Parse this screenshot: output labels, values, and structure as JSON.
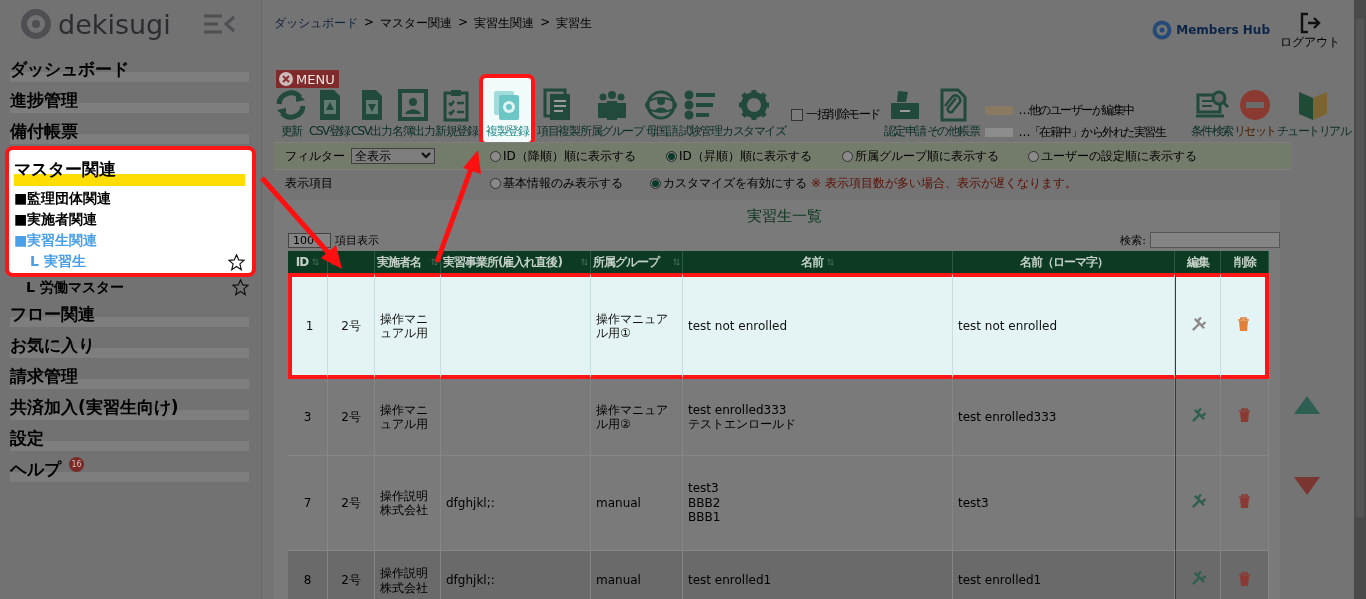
{
  "sidebar": {
    "logo": "dekisugi",
    "nav": [
      {
        "label": "ダッシュボード",
        "selected": false,
        "highlighted": false
      },
      {
        "label": "進捗管理",
        "selected": false,
        "highlighted": false
      },
      {
        "label": "備付帳票",
        "selected": false,
        "highlighted": false
      },
      {
        "label": "マスター関連",
        "selected": true,
        "highlighted": true,
        "children": [
          {
            "label": "■監理団体関連",
            "selected": false,
            "highlighted": true
          },
          {
            "label": "■実施者関連",
            "selected": false,
            "highlighted": true
          },
          {
            "label": "■実習生関連",
            "selected": true,
            "highlighted": true,
            "children": [
              {
                "label": "L 実習生",
                "selected": true,
                "highlighted": true,
                "favorite": false
              },
              {
                "label": "L 労働マスター",
                "selected": false,
                "highlighted": false,
                "favorite": false
              }
            ]
          }
        ]
      },
      {
        "label": "フロー関連",
        "selected": false,
        "highlighted": false
      },
      {
        "label": "お気に入り",
        "selected": false,
        "highlighted": false
      },
      {
        "label": "請求管理",
        "selected": false,
        "highlighted": false
      },
      {
        "label": "共済加入(実習生向け)",
        "selected": false,
        "highlighted": false
      },
      {
        "label": "設定",
        "selected": false,
        "highlighted": false
      },
      {
        "label": "ヘルプ",
        "selected": false,
        "highlighted": false,
        "badge": "16"
      }
    ]
  },
  "header": {
    "breadcrumb": [
      {
        "label": "ダッシュボード",
        "kind": "link"
      },
      {
        "label": ">",
        "kind": "separator"
      },
      {
        "label": "マスター関連",
        "kind": "text"
      },
      {
        "label": ">",
        "kind": "separator"
      },
      {
        "label": "実習生関連",
        "kind": "text"
      },
      {
        "label": ">",
        "kind": "separator"
      },
      {
        "label": "実習生",
        "kind": "text"
      }
    ],
    "brand": "Members Hub",
    "logout": "ログアウト"
  },
  "menu_button": "MENU",
  "toolbar": {
    "buttons": [
      {
        "label": "更新",
        "kind": "refresh",
        "highlighted": false
      },
      {
        "label": "CSV登録",
        "kind": "upload",
        "highlighted": false
      },
      {
        "label": "CSV出力",
        "kind": "download",
        "highlighted": false
      },
      {
        "label": "名簿出力",
        "kind": "portrait",
        "highlighted": false
      },
      {
        "label": "新規登録",
        "kind": "checklist",
        "highlighted": false
      },
      {
        "label": "複製登録",
        "kind": "copy",
        "highlighted": true
      },
      {
        "label": "項目複製",
        "kind": "docs",
        "highlighted": false
      },
      {
        "label": "所属グループ",
        "kind": "group",
        "highlighted": false
      },
      {
        "label": "母国語",
        "kind": "globe",
        "highlighted": false
      },
      {
        "label": "試験管理",
        "kind": "list",
        "highlighted": false
      },
      {
        "label": "カスタマイズ",
        "kind": "gear",
        "highlighted": false
      }
    ],
    "bulk_delete": {
      "label": "一括削除モード",
      "checked": false
    },
    "doc_buttons": [
      {
        "label": "認定申請",
        "kind": "printer",
        "highlighted": false
      },
      {
        "label": "その他帳票",
        "kind": "clip",
        "highlighted": false
      }
    ],
    "legend": [
      {
        "label": "…他のユーザーが編集中",
        "color": "#8a7a62"
      },
      {
        "label": "…「在籍中」から外れた実習生",
        "color": "#8c8c8c"
      }
    ],
    "tool_buttons": [
      {
        "label": "条件検索",
        "kind": "search",
        "highlighted": false
      },
      {
        "label": "リセット",
        "kind": "reset",
        "highlighted": false
      },
      {
        "label": "チュートリアル",
        "kind": "beginner",
        "highlighted": false
      }
    ]
  },
  "filter": {
    "label": "フィルター",
    "select": "全表示",
    "options": [
      {
        "label": "ID（降順）順に表示する",
        "selected": false
      },
      {
        "label": "ID（昇順）順に表示する",
        "selected": true
      },
      {
        "label": "所属グループ順に表示する",
        "selected": false
      },
      {
        "label": "ユーザーの設定順に表示する",
        "selected": false
      }
    ]
  },
  "display": {
    "label": "表示項目",
    "options": [
      {
        "label": "基本情報のみ表示する",
        "selected": false
      },
      {
        "label": "カスタマイズを有効にする",
        "selected": true
      }
    ],
    "note": "※ 表示項目数が多い場合、表示が遅くなります。"
  },
  "list": {
    "title": "実習生一覧",
    "page_size": "100",
    "page_size_label": "項目表示",
    "search_label": "検索:",
    "columns": [
      {
        "label": "ID",
        "sortable": true,
        "kind": "text"
      },
      {
        "sortable": true,
        "kind": "text"
      },
      {
        "label": "実施者名",
        "sortable": true,
        "kind": "text"
      },
      {
        "label": "実習事業所(雇入れ直後)",
        "sortable": true,
        "kind": "text"
      },
      {
        "label": "所属グループ",
        "sortable": true,
        "kind": "text"
      },
      {
        "label": "名前",
        "sortable": true,
        "kind": "text"
      },
      {
        "label": "名前（ローマ字）",
        "sortable": false,
        "kind": "text"
      },
      {
        "label": "編集",
        "sortable": false,
        "kind": "edit"
      },
      {
        "label": "削除",
        "sortable": false,
        "kind": "delete"
      }
    ],
    "rows": [
      {
        "highlighted": true,
        "inactive": false,
        "cells": [
          "1",
          "2号",
          "操作マニュアル用",
          null,
          "操作マニュアル用①",
          "test not enrolled",
          "test not enrolled"
        ]
      },
      {
        "highlighted": false,
        "inactive": false,
        "cells": [
          "3",
          "2号",
          "操作マニュアル用",
          null,
          "操作マニュアル用②",
          "test enrolled333\nテストエンロールド",
          "test enrolled333"
        ]
      },
      {
        "highlighted": false,
        "inactive": false,
        "cells": [
          "7",
          "2号",
          "操作説明株式会社",
          "dfghjkl;:",
          "manual",
          "test3\nBBB2\nBBB1",
          "test3"
        ]
      },
      {
        "highlighted": false,
        "inactive": true,
        "cells": [
          "8",
          "2号",
          "操作説明株式会社",
          "dfghjkl;:",
          "manual",
          "test enrolled1",
          "test enrolled1"
        ]
      }
    ]
  }
}
